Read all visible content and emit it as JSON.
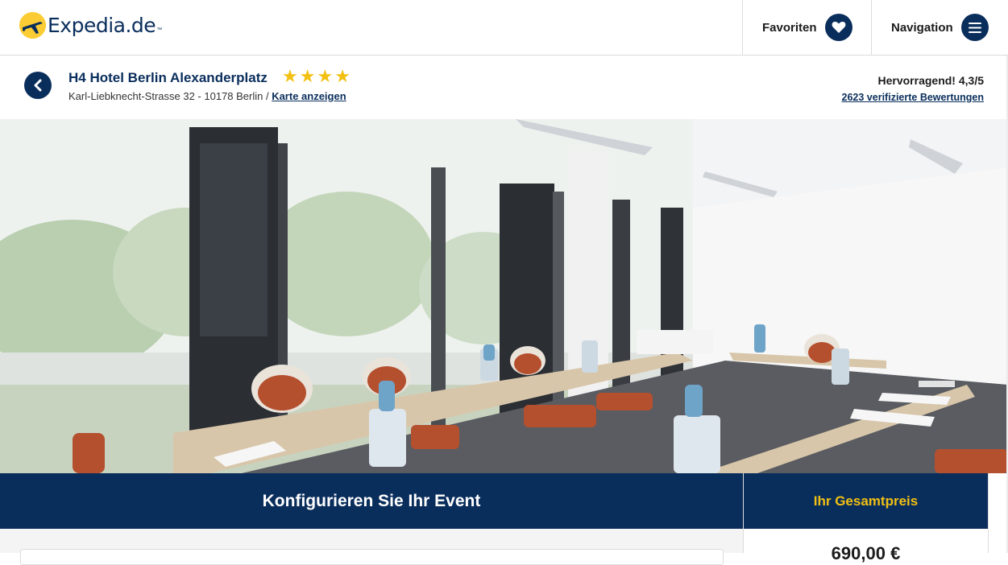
{
  "header": {
    "logo_text": "Expedia.de",
    "logo_tm": "™",
    "favorites_label": "Favoriten",
    "navigation_label": "Navigation"
  },
  "hotel": {
    "name": "H4 Hotel Berlin Alexanderplatz",
    "stars": 4,
    "star_glyph": "★",
    "address": "Karl-Liebknecht-Strasse 32 - 10178 Berlin / ",
    "map_link": "Karte anzeigen",
    "rating_text": "Hervorragend! 4,3/5",
    "reviews_link": "2623 verifizierte Bewertungen"
  },
  "event": {
    "config_title": "Konfigurieren Sie Ihr Event",
    "price_title": "Ihr Gesamtpreis",
    "price_value": "690,00 €"
  },
  "colors": {
    "brand_navy": "#0a2e5c",
    "brand_yellow": "#f2c012",
    "logo_yellow": "#fbcc33"
  }
}
